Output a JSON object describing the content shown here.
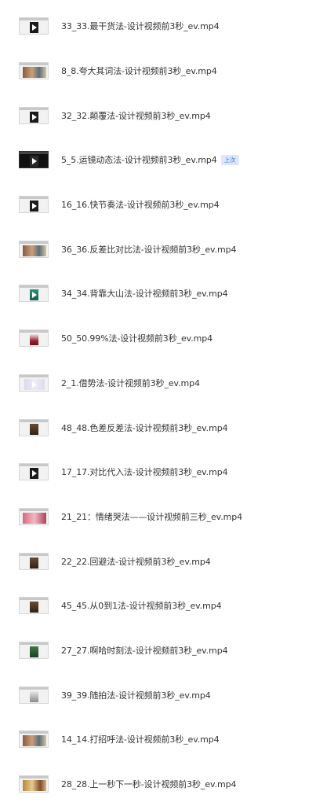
{
  "files": [
    {
      "name": "33_33.最干货法-设计视频前3秒_ev.mp4",
      "thumb": "dark-frame"
    },
    {
      "name": "8_8.夸大其词法-设计视频前3秒_ev.mp4",
      "thumb": "photo-collage"
    },
    {
      "name": "32_32.颠覆法-设计视频前3秒_ev.mp4",
      "thumb": "dark-frame"
    },
    {
      "name": "5_5.运镜动态法-设计视频前3秒_ev.mp4",
      "thumb": "dark-full",
      "badge": "上次"
    },
    {
      "name": "16_16.快节奏法-设计视频前3秒_ev.mp4",
      "thumb": "dark-frame"
    },
    {
      "name": "36_36.反差比对比法-设计视频前3秒_ev.mp4",
      "thumb": "photo-collage"
    },
    {
      "name": "34_34.背靠大山法-设计视频前3秒_ev.mp4",
      "thumb": "teal-frame"
    },
    {
      "name": "50_50.99%法-设计视频前3秒_ev.mp4",
      "thumb": "red-frame"
    },
    {
      "name": "2_1.借势法-设计视频前3秒_ev.mp4",
      "thumb": "light-frame"
    },
    {
      "name": "48_48.色差反差法-设计视频前3秒_ev.mp4",
      "thumb": "brown-frame"
    },
    {
      "name": "17_17.对比代入法-设计视频前3秒_ev.mp4",
      "thumb": "dark-frame"
    },
    {
      "name": "21_21：情绪哭法——设计视频前三秒_ev.mp4",
      "thumb": "pink-frame"
    },
    {
      "name": "22_22.回避法-设计视频前3秒_ev.mp4",
      "thumb": "brown-frame"
    },
    {
      "name": "45_45.从0到1法-设计视频前3秒_ev.mp4",
      "thumb": "brown-frame"
    },
    {
      "name": "27_27.啊哈时刻法-设计视频前3秒_ev.mp4",
      "thumb": "green-frame"
    },
    {
      "name": "39_39.随拍法-设计视频前3秒_ev.mp4",
      "thumb": "gray-frame"
    },
    {
      "name": "14_14.打招呼法-设计视频前3秒_ev.mp4",
      "thumb": "photo-collage"
    },
    {
      "name": "28_28.上一秒下一秒-设计视频前3秒_ev.mp4",
      "thumb": "warm-collage"
    }
  ]
}
